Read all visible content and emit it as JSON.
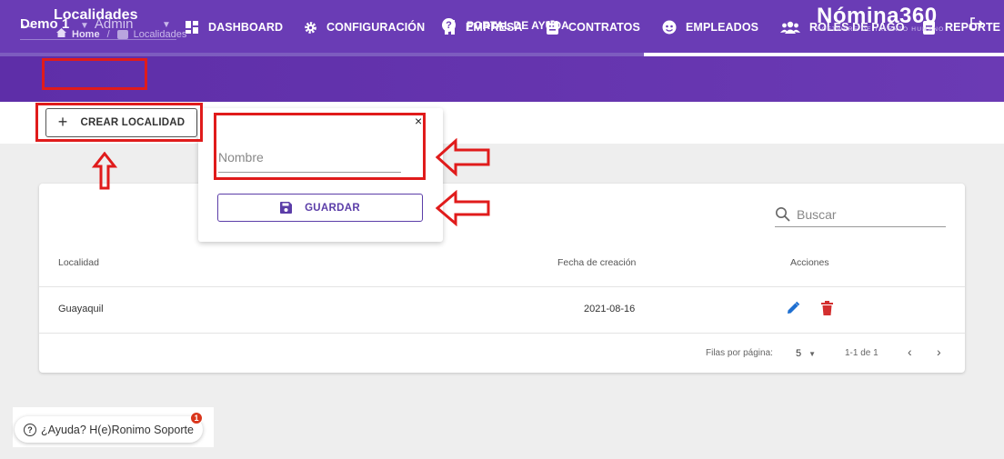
{
  "topnav": {
    "company": "Demo 1",
    "role": "Admin",
    "items": [
      {
        "label": "DASHBOARD",
        "icon": "dashboard-icon"
      },
      {
        "label": "CONFIGURACIÓN",
        "icon": "gear-icon"
      },
      {
        "label": "EMPRESA",
        "icon": "building-icon"
      },
      {
        "label": "CONTRATOS",
        "icon": "clipboard-icon"
      },
      {
        "label": "EMPLEADOS",
        "icon": "face-icon"
      },
      {
        "label": "ROLES DE PAGO",
        "icon": "people-icon"
      },
      {
        "label": "REPORTE",
        "icon": "report-icon"
      }
    ],
    "colors": {
      "primary": "#6a3cb5",
      "accent": "#5b3da8",
      "annotation": "#e01b1b"
    }
  },
  "subheader": {
    "title": "Localidades",
    "breadcrumb": [
      "Home",
      "Localidades"
    ],
    "help_label": "PORTAL DE AYUDA",
    "logo_name": "Nómina360",
    "logo_tagline": "SOFTWARE DE TALENTO HUMANO"
  },
  "toolbar": {
    "create_label": "CREAR LOCALIDAD"
  },
  "popover": {
    "close_glyph": "×",
    "name_placeholder": "Nombre",
    "save_label": "GUARDAR"
  },
  "table": {
    "search_placeholder": "Buscar",
    "columns": [
      "Localidad",
      "Fecha de creación",
      "Acciones"
    ],
    "rows": [
      {
        "localidad": "Guayaquil",
        "fecha": "2021-08-16"
      }
    ],
    "rows_per_page_label": "Filas por página:",
    "rows_per_page": "5",
    "range": "1-1 de 1"
  },
  "help_widget": {
    "label": "¿Ayuda? H(e)Ronimo Soporte",
    "badge": "1"
  }
}
